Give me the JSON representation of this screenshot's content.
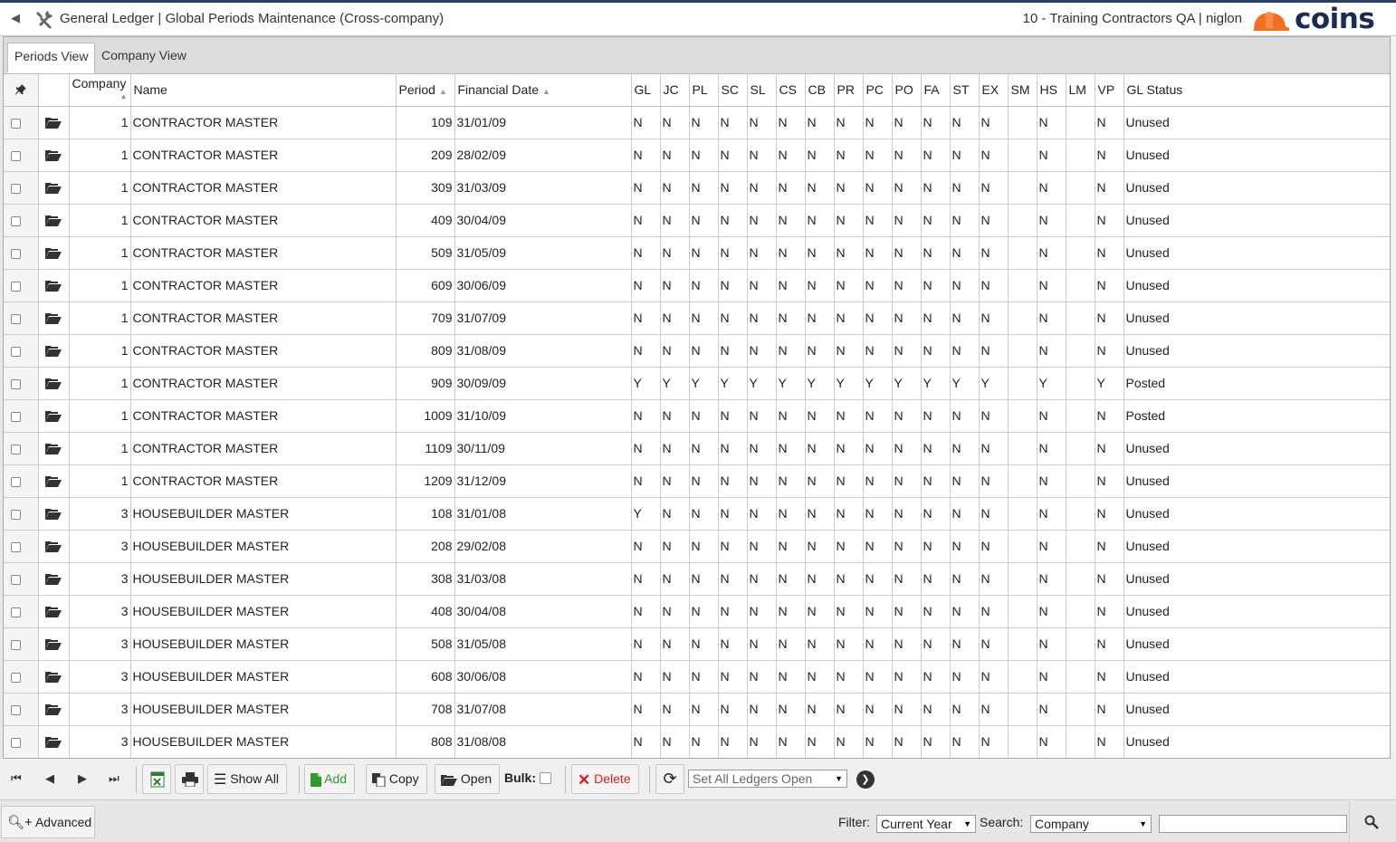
{
  "header": {
    "title": "General Ledger | Global Periods Maintenance (Cross-company)",
    "user_info": "10 - Training Contractors QA | niglon",
    "logo_text": "coins",
    "brand_color": "#1c2b52",
    "accent_color": "#f36f21"
  },
  "tabs": [
    {
      "label": "Periods View",
      "active": true
    },
    {
      "label": "Company View",
      "active": false
    }
  ],
  "columns": {
    "company": "Company",
    "name": "Name",
    "period": "Period",
    "financial_date": "Financial Date",
    "ledgers": [
      "GL",
      "JC",
      "PL",
      "SC",
      "SL",
      "CS",
      "CB",
      "PR",
      "PC",
      "PO",
      "FA",
      "ST",
      "EX",
      "SM",
      "HS",
      "LM",
      "VP"
    ],
    "gl_status": "GL Status"
  },
  "rows": [
    {
      "company": "1",
      "name": "CONTRACTOR MASTER",
      "period": "109",
      "date": "31/01/09",
      "flags": [
        "N",
        "N",
        "N",
        "N",
        "N",
        "N",
        "N",
        "N",
        "N",
        "N",
        "N",
        "N",
        "N",
        "",
        "N",
        "",
        "N"
      ],
      "status": "Unused"
    },
    {
      "company": "1",
      "name": "CONTRACTOR MASTER",
      "period": "209",
      "date": "28/02/09",
      "flags": [
        "N",
        "N",
        "N",
        "N",
        "N",
        "N",
        "N",
        "N",
        "N",
        "N",
        "N",
        "N",
        "N",
        "",
        "N",
        "",
        "N"
      ],
      "status": "Unused"
    },
    {
      "company": "1",
      "name": "CONTRACTOR MASTER",
      "period": "309",
      "date": "31/03/09",
      "flags": [
        "N",
        "N",
        "N",
        "N",
        "N",
        "N",
        "N",
        "N",
        "N",
        "N",
        "N",
        "N",
        "N",
        "",
        "N",
        "",
        "N"
      ],
      "status": "Unused"
    },
    {
      "company": "1",
      "name": "CONTRACTOR MASTER",
      "period": "409",
      "date": "30/04/09",
      "flags": [
        "N",
        "N",
        "N",
        "N",
        "N",
        "N",
        "N",
        "N",
        "N",
        "N",
        "N",
        "N",
        "N",
        "",
        "N",
        "",
        "N"
      ],
      "status": "Unused"
    },
    {
      "company": "1",
      "name": "CONTRACTOR MASTER",
      "period": "509",
      "date": "31/05/09",
      "flags": [
        "N",
        "N",
        "N",
        "N",
        "N",
        "N",
        "N",
        "N",
        "N",
        "N",
        "N",
        "N",
        "N",
        "",
        "N",
        "",
        "N"
      ],
      "status": "Unused"
    },
    {
      "company": "1",
      "name": "CONTRACTOR MASTER",
      "period": "609",
      "date": "30/06/09",
      "flags": [
        "N",
        "N",
        "N",
        "N",
        "N",
        "N",
        "N",
        "N",
        "N",
        "N",
        "N",
        "N",
        "N",
        "",
        "N",
        "",
        "N"
      ],
      "status": "Unused"
    },
    {
      "company": "1",
      "name": "CONTRACTOR MASTER",
      "period": "709",
      "date": "31/07/09",
      "flags": [
        "N",
        "N",
        "N",
        "N",
        "N",
        "N",
        "N",
        "N",
        "N",
        "N",
        "N",
        "N",
        "N",
        "",
        "N",
        "",
        "N"
      ],
      "status": "Unused"
    },
    {
      "company": "1",
      "name": "CONTRACTOR MASTER",
      "period": "809",
      "date": "31/08/09",
      "flags": [
        "N",
        "N",
        "N",
        "N",
        "N",
        "N",
        "N",
        "N",
        "N",
        "N",
        "N",
        "N",
        "N",
        "",
        "N",
        "",
        "N"
      ],
      "status": "Unused"
    },
    {
      "company": "1",
      "name": "CONTRACTOR MASTER",
      "period": "909",
      "date": "30/09/09",
      "flags": [
        "Y",
        "Y",
        "Y",
        "Y",
        "Y",
        "Y",
        "Y",
        "Y",
        "Y",
        "Y",
        "Y",
        "Y",
        "Y",
        "",
        "Y",
        "",
        "Y"
      ],
      "status": "Posted"
    },
    {
      "company": "1",
      "name": "CONTRACTOR MASTER",
      "period": "1009",
      "date": "31/10/09",
      "flags": [
        "N",
        "N",
        "N",
        "N",
        "N",
        "N",
        "N",
        "N",
        "N",
        "N",
        "N",
        "N",
        "N",
        "",
        "N",
        "",
        "N"
      ],
      "status": "Posted"
    },
    {
      "company": "1",
      "name": "CONTRACTOR MASTER",
      "period": "1109",
      "date": "30/11/09",
      "flags": [
        "N",
        "N",
        "N",
        "N",
        "N",
        "N",
        "N",
        "N",
        "N",
        "N",
        "N",
        "N",
        "N",
        "",
        "N",
        "",
        "N"
      ],
      "status": "Unused"
    },
    {
      "company": "1",
      "name": "CONTRACTOR MASTER",
      "period": "1209",
      "date": "31/12/09",
      "flags": [
        "N",
        "N",
        "N",
        "N",
        "N",
        "N",
        "N",
        "N",
        "N",
        "N",
        "N",
        "N",
        "N",
        "",
        "N",
        "",
        "N"
      ],
      "status": "Unused"
    },
    {
      "company": "3",
      "name": "HOUSEBUILDER MASTER",
      "period": "108",
      "date": "31/01/08",
      "flags": [
        "Y",
        "N",
        "N",
        "N",
        "N",
        "N",
        "N",
        "N",
        "N",
        "N",
        "N",
        "N",
        "N",
        "",
        "N",
        "",
        "N"
      ],
      "status": "Unused"
    },
    {
      "company": "3",
      "name": "HOUSEBUILDER MASTER",
      "period": "208",
      "date": "29/02/08",
      "flags": [
        "N",
        "N",
        "N",
        "N",
        "N",
        "N",
        "N",
        "N",
        "N",
        "N",
        "N",
        "N",
        "N",
        "",
        "N",
        "",
        "N"
      ],
      "status": "Unused"
    },
    {
      "company": "3",
      "name": "HOUSEBUILDER MASTER",
      "period": "308",
      "date": "31/03/08",
      "flags": [
        "N",
        "N",
        "N",
        "N",
        "N",
        "N",
        "N",
        "N",
        "N",
        "N",
        "N",
        "N",
        "N",
        "",
        "N",
        "",
        "N"
      ],
      "status": "Unused"
    },
    {
      "company": "3",
      "name": "HOUSEBUILDER MASTER",
      "period": "408",
      "date": "30/04/08",
      "flags": [
        "N",
        "N",
        "N",
        "N",
        "N",
        "N",
        "N",
        "N",
        "N",
        "N",
        "N",
        "N",
        "N",
        "",
        "N",
        "",
        "N"
      ],
      "status": "Unused"
    },
    {
      "company": "3",
      "name": "HOUSEBUILDER MASTER",
      "period": "508",
      "date": "31/05/08",
      "flags": [
        "N",
        "N",
        "N",
        "N",
        "N",
        "N",
        "N",
        "N",
        "N",
        "N",
        "N",
        "N",
        "N",
        "",
        "N",
        "",
        "N"
      ],
      "status": "Unused"
    },
    {
      "company": "3",
      "name": "HOUSEBUILDER MASTER",
      "period": "608",
      "date": "30/06/08",
      "flags": [
        "N",
        "N",
        "N",
        "N",
        "N",
        "N",
        "N",
        "N",
        "N",
        "N",
        "N",
        "N",
        "N",
        "",
        "N",
        "",
        "N"
      ],
      "status": "Unused"
    },
    {
      "company": "3",
      "name": "HOUSEBUILDER MASTER",
      "period": "708",
      "date": "31/07/08",
      "flags": [
        "N",
        "N",
        "N",
        "N",
        "N",
        "N",
        "N",
        "N",
        "N",
        "N",
        "N",
        "N",
        "N",
        "",
        "N",
        "",
        "N"
      ],
      "status": "Unused"
    },
    {
      "company": "3",
      "name": "HOUSEBUILDER MASTER",
      "period": "808",
      "date": "31/08/08",
      "flags": [
        "N",
        "N",
        "N",
        "N",
        "N",
        "N",
        "N",
        "N",
        "N",
        "N",
        "N",
        "N",
        "N",
        "",
        "N",
        "",
        "N"
      ],
      "status": "Unused"
    }
  ],
  "toolbar": {
    "show_all": "Show All",
    "add": "Add",
    "copy": "Copy",
    "open": "Open",
    "bulk": "Bulk:",
    "delete": "Delete",
    "action_select": "Set All Ledgers Open",
    "add_color": "#2e9b2e",
    "delete_color": "#d02020"
  },
  "footer": {
    "advanced": "Advanced",
    "filter_label": "Filter:",
    "filter_value": "Current Year",
    "search_label": "Search:",
    "search_field": "Company",
    "search_value": ""
  }
}
